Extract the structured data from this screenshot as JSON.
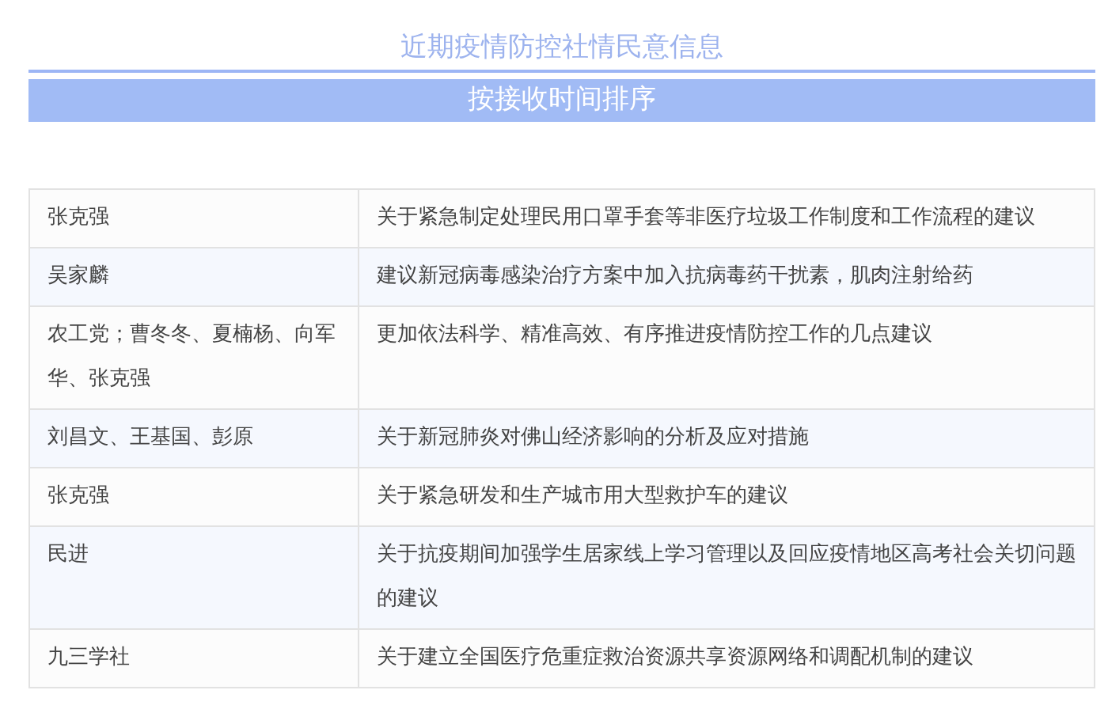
{
  "title": "近期疫情防控社情民意信息",
  "banner": "按接收时间排序",
  "table": {
    "rows": [
      {
        "author": "张克强",
        "subject": "关于紧急制定处理民用口罩手套等非医疗垃圾工作制度和工作流程的建议"
      },
      {
        "author": "吴家麟",
        "subject": "建议新冠病毒感染治疗方案中加入抗病毒药干扰素，肌肉注射给药"
      },
      {
        "author": "农工党；曹冬冬、夏楠杨、向军华、张克强",
        "subject": "更加依法科学、精准高效、有序推进疫情防控工作的几点建议"
      },
      {
        "author": "刘昌文、王基国、彭原",
        "subject": "关于新冠肺炎对佛山经济影响的分析及应对措施"
      },
      {
        "author": "张克强",
        "subject": "关于紧急研发和生产城市用大型救护车的建议"
      },
      {
        "author": "民进",
        "subject": "关于抗疫期间加强学生居家线上学习管理以及回应疫情地区高考社会关切问题的建议"
      },
      {
        "author": "九三学社",
        "subject": "关于建立全国医疗危重症救治资源共享资源网络和调配机制的建议"
      }
    ]
  }
}
